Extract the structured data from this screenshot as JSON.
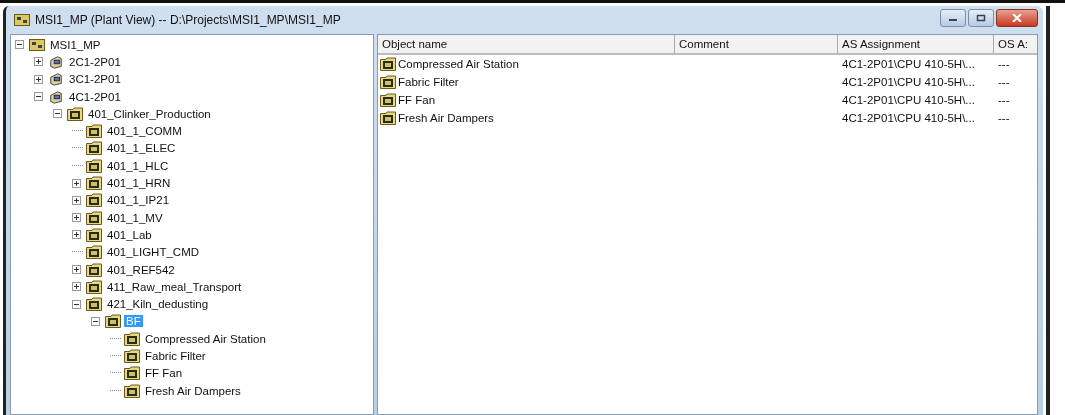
{
  "window": {
    "title": "MSI1_MP (Plant View) -- D:\\Projects\\MSI1_MP\\MSI1_MP"
  },
  "tree": [
    {
      "label": "MSI1_MP",
      "kind": "project",
      "expanded": true,
      "selected": false,
      "children": [
        {
          "label": "2C1-2P01",
          "kind": "station",
          "expanded": false,
          "selected": false
        },
        {
          "label": "3C1-2P01",
          "kind": "station",
          "expanded": false,
          "selected": false
        },
        {
          "label": "4C1-2P01",
          "kind": "station",
          "expanded": true,
          "selected": false,
          "children": [
            {
              "label": "401_Clinker_Production",
              "kind": "folder",
              "expanded": true,
              "selected": false,
              "children": [
                {
                  "label": "401_1_COMM",
                  "kind": "folder",
                  "selected": false
                },
                {
                  "label": "401_1_ELEC",
                  "kind": "folder",
                  "selected": false
                },
                {
                  "label": "401_1_HLC",
                  "kind": "folder",
                  "selected": false
                },
                {
                  "label": "401_1_HRN",
                  "kind": "folder",
                  "expanded": false,
                  "selected": false
                },
                {
                  "label": "401_1_IP21",
                  "kind": "folder",
                  "expanded": false,
                  "selected": false
                },
                {
                  "label": "401_1_MV",
                  "kind": "folder",
                  "expanded": false,
                  "selected": false
                },
                {
                  "label": "401_Lab",
                  "kind": "folder",
                  "expanded": false,
                  "selected": false
                },
                {
                  "label": "401_LIGHT_CMD",
                  "kind": "folder",
                  "selected": false
                },
                {
                  "label": "401_REF542",
                  "kind": "folder",
                  "expanded": false,
                  "selected": false
                },
                {
                  "label": "411_Raw_meal_Transport",
                  "kind": "folder",
                  "expanded": false,
                  "selected": false
                },
                {
                  "label": "421_Kiln_dedusting",
                  "kind": "folder",
                  "expanded": true,
                  "selected": false,
                  "children": [
                    {
                      "label": "BF",
                      "kind": "folder",
                      "expanded": true,
                      "selected": true,
                      "children": [
                        {
                          "label": "Compressed Air Station",
                          "kind": "folder",
                          "selected": false
                        },
                        {
                          "label": "Fabric Filter",
                          "kind": "folder",
                          "selected": false
                        },
                        {
                          "label": "FF Fan",
                          "kind": "folder",
                          "selected": false
                        },
                        {
                          "label": "Fresh Air Dampers",
                          "kind": "folder",
                          "selected": false
                        }
                      ]
                    }
                  ]
                }
              ]
            }
          ]
        }
      ]
    }
  ],
  "table": {
    "columns": [
      "Object name",
      "Comment",
      "AS Assignment",
      "OS A:"
    ],
    "rows": [
      {
        "name": "Compressed Air Station",
        "as_assignment": "4C1-2P01\\CPU 410-5H\\...",
        "os": "---"
      },
      {
        "name": "Fabric Filter",
        "as_assignment": "4C1-2P01\\CPU 410-5H\\...",
        "os": "---"
      },
      {
        "name": "FF Fan",
        "as_assignment": "4C1-2P01\\CPU 410-5H\\...",
        "os": "---"
      },
      {
        "name": "Fresh Air Dampers",
        "as_assignment": "4C1-2P01\\CPU 410-5H\\...",
        "os": "---"
      }
    ]
  }
}
